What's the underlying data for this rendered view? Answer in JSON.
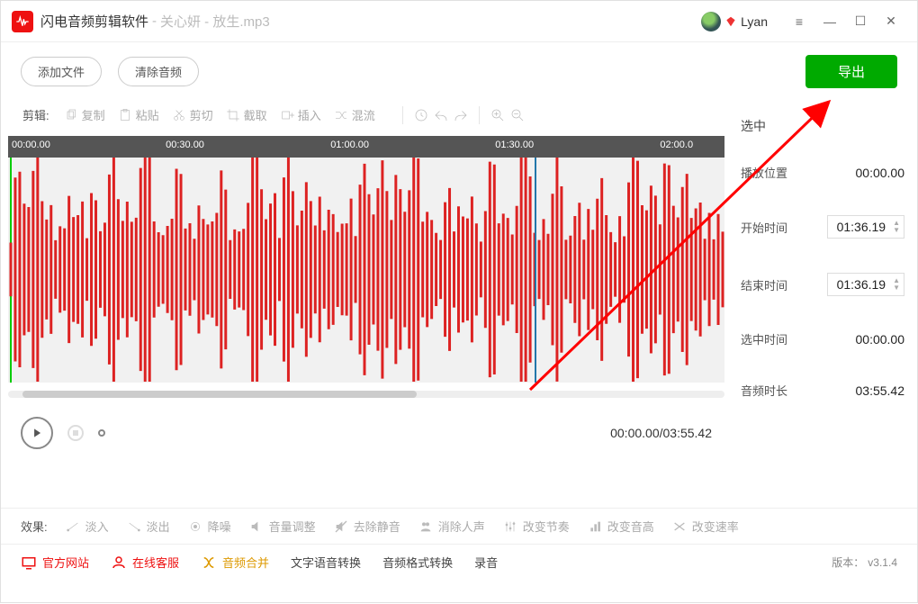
{
  "title": {
    "app_name": "闪电音频剪辑软件",
    "sep": " - ",
    "file_name": "关心妍 - 放生.mp3"
  },
  "user": {
    "name": "Lyan"
  },
  "actions": {
    "add_file": "添加文件",
    "clear_audio": "清除音频",
    "export": "导出"
  },
  "toolbar": {
    "label": "剪辑:",
    "copy": "复制",
    "paste": "粘贴",
    "cut": "剪切",
    "crop": "截取",
    "insert": "插入",
    "mix": "混流"
  },
  "timeline": {
    "ticks": [
      "00:00.00",
      "00:30.00",
      "01:00.00",
      "01:30.00",
      "02:00.0"
    ],
    "playhead_pct": 73.5
  },
  "player": {
    "time_text": "00:00.00/03:55.42"
  },
  "side": {
    "header": "选中",
    "play_pos_label": "播放位置",
    "play_pos": "00:00.00",
    "start_label": "开始时间",
    "start": "01:36.19",
    "end_label": "结束时间",
    "end": "01:36.19",
    "sel_label": "选中时间",
    "sel": "00:00.00",
    "dur_label": "音频时长",
    "dur": "03:55.42"
  },
  "fx": {
    "label": "效果:",
    "fadein": "淡入",
    "fadeout": "淡出",
    "denoise": "降噪",
    "volume": "音量调整",
    "trimsil": "去除静音",
    "devocal": "消除人声",
    "tempo": "改变节奏",
    "pitch": "改变音高",
    "speed": "改变速率"
  },
  "footer": {
    "site": "官方网站",
    "chat": "在线客服",
    "merge": "音频合并",
    "tts": "文字语音转换",
    "format": "音频格式转换",
    "record": "录音",
    "version_label": "版本：",
    "version": "v3.1.4"
  }
}
